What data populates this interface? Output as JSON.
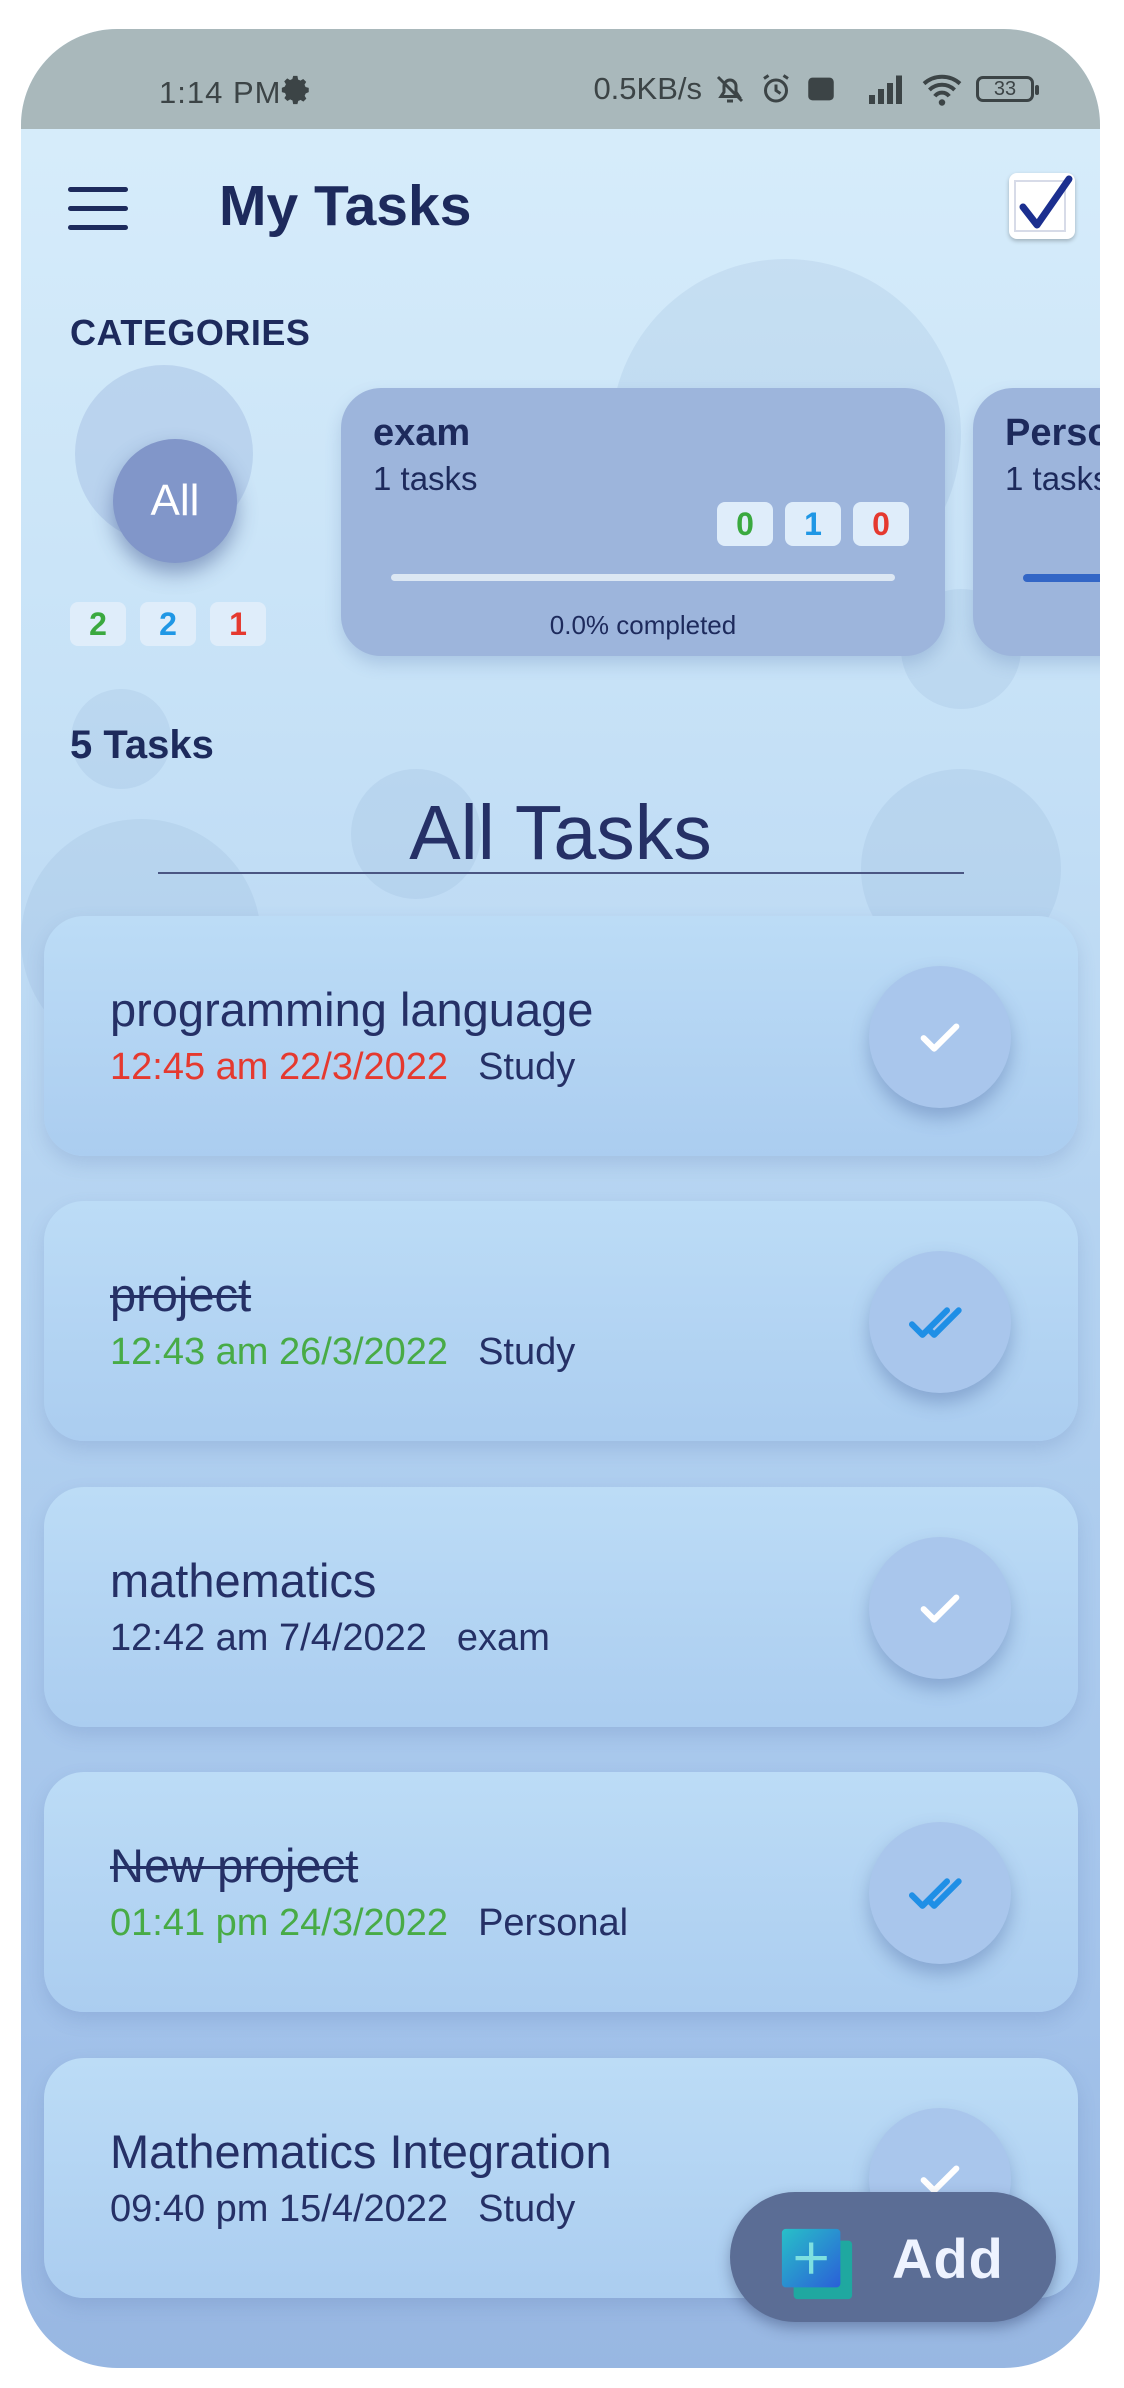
{
  "status_bar": {
    "time": "1:14 PM",
    "network_speed": "0.5KB/s",
    "battery": "33"
  },
  "header": {
    "title": "My Tasks"
  },
  "categories": {
    "label": "CATEGORIES",
    "all": {
      "label": "All",
      "counts": {
        "green": "2",
        "blue": "2",
        "red": "1"
      }
    },
    "cards": [
      {
        "name": "exam",
        "tasks": "1 tasks",
        "counts": {
          "green": "0",
          "blue": "1",
          "red": "0"
        },
        "progress": "0.0% completed"
      },
      {
        "name": "Personal",
        "tasks": "1 tasks"
      }
    ]
  },
  "task_count": "5 Tasks",
  "section_title": "All Tasks",
  "tasks": [
    {
      "name": "programming language",
      "date": "12:45 am 22/3/2022",
      "category": "Study",
      "done": false
    },
    {
      "name": "project",
      "date": "12:43 am 26/3/2022",
      "category": "Study",
      "done": true
    },
    {
      "name": "mathematics",
      "date": "12:42 am 7/4/2022",
      "category": "exam",
      "done": false
    },
    {
      "name": "New project",
      "date": "01:41 pm 24/3/2022",
      "category": "Personal",
      "done": true
    },
    {
      "name": "Mathematics Integration",
      "date": "09:40 pm 15/4/2022",
      "category": "Study",
      "done": false
    }
  ],
  "fab": {
    "label": "Add"
  },
  "colors": {
    "primary_text": "#1d2a5c",
    "overdue": "#e5392f",
    "completed": "#48ab46",
    "accent_blue": "#1f97e5"
  }
}
